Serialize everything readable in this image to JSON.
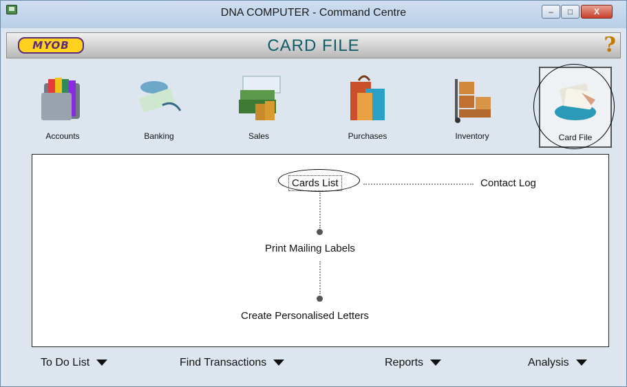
{
  "window": {
    "title": "DNA COMPUTER - Command Centre",
    "controls": {
      "minimize": "–",
      "maximize": "□",
      "close": "X"
    }
  },
  "header": {
    "logo": "MYOB",
    "section_title": "CARD FILE",
    "help": "?"
  },
  "modules": [
    {
      "label": "Accounts",
      "icon": "folders-icon"
    },
    {
      "label": "Banking",
      "icon": "check-icon"
    },
    {
      "label": "Sales",
      "icon": "invoice-coins-icon"
    },
    {
      "label": "Purchases",
      "icon": "shopping-bags-icon"
    },
    {
      "label": "Inventory",
      "icon": "boxes-cart-icon"
    },
    {
      "label": "Card File",
      "icon": "card-file-icon",
      "selected": true
    }
  ],
  "panel": {
    "cards_list": "Cards List",
    "contact_log": "Contact Log",
    "print_mailing_labels": "Print Mailing Labels",
    "create_letters": "Create Personalised Letters"
  },
  "bottom": {
    "todo": "To Do List",
    "find": "Find Transactions",
    "reports": "Reports",
    "analysis": "Analysis"
  },
  "colors": {
    "title_bar": "#b9cfe7",
    "section_title": "#0f5c68",
    "logo_bg": "#ffd21f",
    "logo_text": "#5b2a7a"
  }
}
